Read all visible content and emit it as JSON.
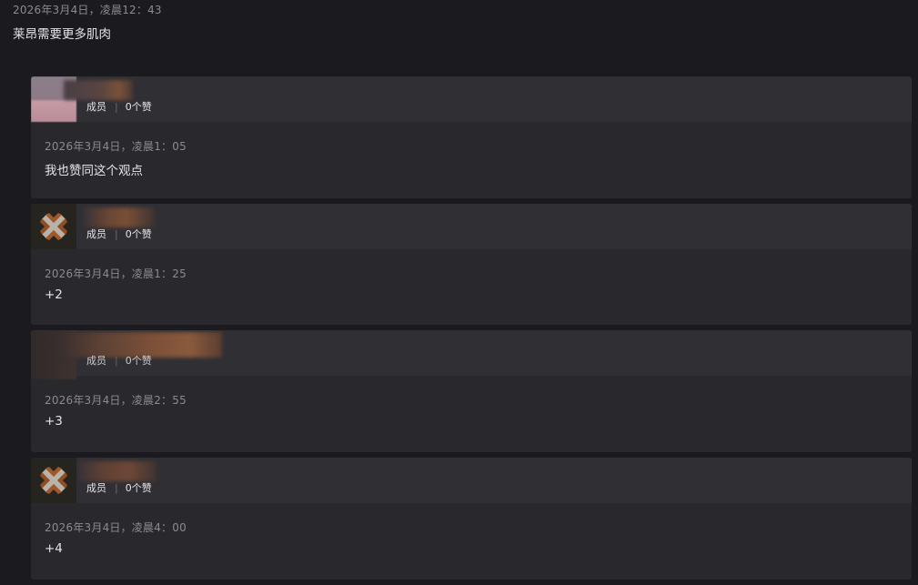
{
  "main_post": {
    "timestamp": "2026年3月4日，凌晨12：43",
    "content": "莱昂需要更多肌肉"
  },
  "replies": [
    {
      "role": "成员",
      "likes": "0个赞",
      "timestamp": "2026年3月4日，凌晨1：05",
      "content": "我也赞同这个观点",
      "avatar_icon": "blurred-avatar"
    },
    {
      "role": "成员",
      "likes": "0个赞",
      "timestamp": "2026年3月4日，凌晨1：25",
      "content": "+2",
      "avatar_icon": "default-cross-avatar"
    },
    {
      "role": "成员",
      "likes": "0个赞",
      "timestamp": "2026年3月4日，凌晨2：55",
      "content": "+3",
      "avatar_icon": "blurred-avatar"
    },
    {
      "role": "成员",
      "likes": "0个赞",
      "timestamp": "2026年3月4日，凌晨4：00",
      "content": "+4",
      "avatar_icon": "default-cross-avatar"
    }
  ],
  "colors": {
    "background": "#1b1b1f",
    "card": "#28282d",
    "card_header": "#2f2f34",
    "meta_text": "#8a8a92",
    "body_text": "#e4e4e7"
  }
}
